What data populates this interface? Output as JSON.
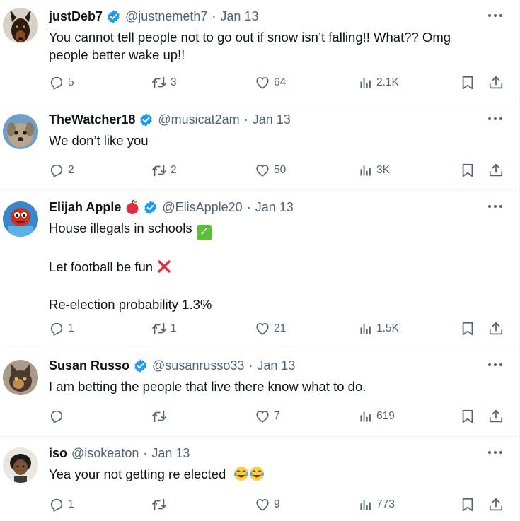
{
  "tweets": [
    {
      "name": "justDeb7",
      "handle": "@justnemeth7",
      "dot": "·",
      "date": "Jan 13",
      "lines": [
        "You cannot tell people not to go out if snow isn’t falling!! What?? Omg",
        "people better wake up!!"
      ],
      "replies": "5",
      "retweets": "3",
      "likes": "64",
      "views": "2.1K"
    },
    {
      "name": "TheWatcher18",
      "handle": "@musicat2am",
      "dot": "·",
      "date": "Jan 13",
      "lines": [
        "We don’t like you"
      ],
      "replies": "2",
      "retweets": "2",
      "likes": "50",
      "views": "3K"
    },
    {
      "name": "Elijah Apple",
      "handle": "@ElisApple20",
      "dot": "·",
      "date": "Jan 13",
      "lines": [
        "House illegals in schools",
        "",
        "Let football be fun",
        "",
        "Re-election probability 1.3%"
      ],
      "replies": "1",
      "retweets": "1",
      "likes": "21",
      "views": "1.5K"
    },
    {
      "name": "Susan Russo",
      "handle": "@susanrusso33",
      "dot": "·",
      "date": "Jan 13",
      "lines": [
        "I am betting the people that live there know what to do."
      ],
      "replies": "",
      "retweets": "",
      "likes": "7",
      "views": "619"
    },
    {
      "name": "iso",
      "handle": "@isokeaton",
      "dot": "·",
      "date": "Jan 13",
      "lines": [
        "Yea your not getting re elected"
      ],
      "replies": "1",
      "retweets": "",
      "likes": "9",
      "views": "773"
    }
  ],
  "icons": {
    "reply": "reply-icon",
    "retweet": "retweet-icon",
    "like": "heart-icon",
    "views": "views-icon",
    "bookmark": "bookmark-icon",
    "share": "share-icon",
    "more": "more-icon",
    "verified": "verified-badge-icon"
  },
  "colors": {
    "text": "#0f1419",
    "secondary": "#536471",
    "verified": "#1d9bf0",
    "divider": "#eff3f4"
  }
}
